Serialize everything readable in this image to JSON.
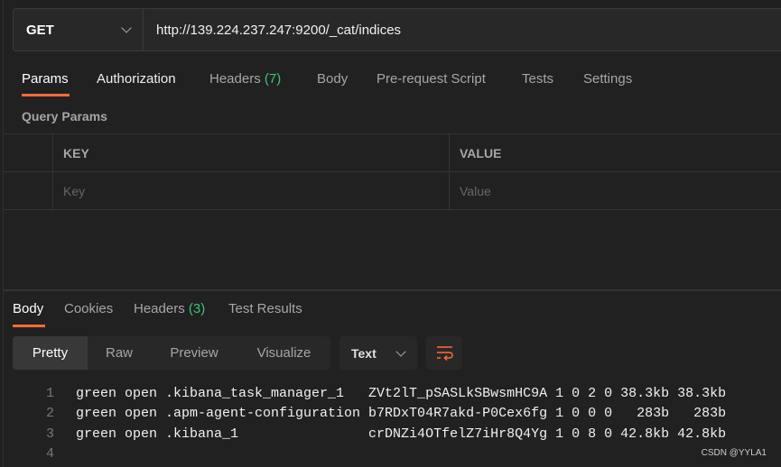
{
  "request": {
    "method": "GET",
    "url": "http://139.224.237.247:9200/_cat/indices"
  },
  "request_tabs": [
    {
      "label": "Params",
      "active": true
    },
    {
      "label": "Authorization"
    },
    {
      "label": "Headers",
      "count": "(7)"
    },
    {
      "label": "Body"
    },
    {
      "label": "Pre-request Script"
    },
    {
      "label": "Tests"
    },
    {
      "label": "Settings"
    }
  ],
  "query_params": {
    "title": "Query Params",
    "headers": [
      "KEY",
      "VALUE"
    ],
    "key_placeholder": "Key",
    "value_placeholder": "Value"
  },
  "response_tabs": [
    {
      "label": "Body",
      "active": true
    },
    {
      "label": "Cookies"
    },
    {
      "label": "Headers",
      "count": "(3)"
    },
    {
      "label": "Test Results"
    }
  ],
  "view_modes": [
    "Pretty",
    "Raw",
    "Preview",
    "Visualize"
  ],
  "active_view": "Pretty",
  "format": "Text",
  "accent": "#ff6c37",
  "count_color": "#3ac778",
  "response_lines": [
    {
      "n": "1",
      "text": "green open .kibana_task_manager_1   ZVt2lT_pSASLkSBwsmHC9A 1 0 2 0 38.3kb 38.3kb"
    },
    {
      "n": "2",
      "text": "green open .apm-agent-configuration b7RDxT04R7akd-P0Cex6fg 1 0 0 0   283b   283b"
    },
    {
      "n": "3",
      "text": "green open .kibana_1                crDNZi4OTfelZ7iHr8Q4Yg 1 0 8 0 42.8kb 42.8kb"
    },
    {
      "n": "4",
      "text": ""
    }
  ],
  "watermark": "CSDN @YYLA1"
}
